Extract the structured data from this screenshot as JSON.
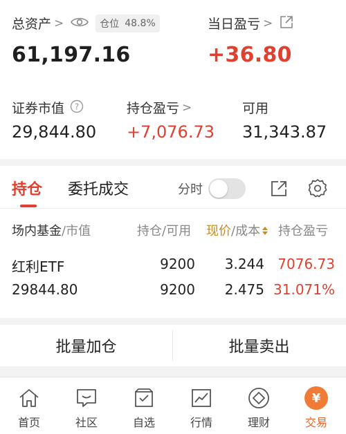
{
  "summary": {
    "total_assets_label": "总资产",
    "position_ratio_label": "仓位",
    "position_ratio_value": "48.8%",
    "total_assets_value": "61,197.16",
    "daily_pnl_label": "当日盈亏",
    "daily_pnl_value": "+36.80",
    "market_value_label": "证券市值",
    "market_value_value": "29,844.80",
    "holding_pnl_label": "持仓盈亏",
    "holding_pnl_value": "+7,076.73",
    "available_label": "可用",
    "available_value": "31,343.87"
  },
  "tabs": {
    "holdings": "持仓",
    "orders": "委托成交",
    "timeshare": "分时"
  },
  "columns": {
    "name_a": "场内基金",
    "name_b": "/市值",
    "position_a": "持仓",
    "position_b": "/可用",
    "price_a": "现价",
    "price_b": "/成本",
    "pnl": "持仓盈亏"
  },
  "holding": {
    "name": "红利ETF",
    "market_value": "29844.80",
    "position": "9200",
    "available": "9200",
    "price": "3.244",
    "cost": "2.475",
    "pnl": "7076.73",
    "pnl_pct": "31.071%"
  },
  "batch": {
    "add": "批量加仓",
    "sell": "批量卖出"
  },
  "nav": [
    {
      "label": "首页",
      "icon": "home-icon"
    },
    {
      "label": "社区",
      "icon": "chat-icon"
    },
    {
      "label": "自选",
      "icon": "watchlist-icon"
    },
    {
      "label": "行情",
      "icon": "chart-icon"
    },
    {
      "label": "理财",
      "icon": "diamond-icon"
    },
    {
      "label": "交易",
      "icon": "yuan-icon",
      "symbol": "¥"
    }
  ],
  "colors": {
    "accent_red": "#e0402f",
    "accent_orange": "#f07b36",
    "sort_gold": "#c98a1f"
  }
}
